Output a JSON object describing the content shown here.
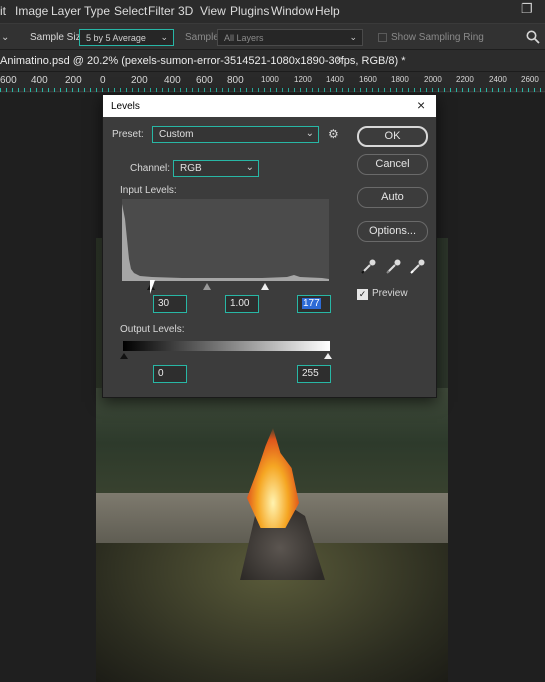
{
  "menubar": {
    "items": [
      "it",
      "Image",
      "Layer",
      "Type",
      "Select",
      "Filter",
      "3D",
      "View",
      "Plugins",
      "Window",
      "Help"
    ],
    "restore_glyph": "❐"
  },
  "options": {
    "sample_size_label": "Sample Size:",
    "sample_size_value": "5 by 5 Average",
    "sample_label": "Sample:",
    "sample_value": "All Layers",
    "show_ring_label": "Show Sampling Ring"
  },
  "document": {
    "tab_title": "Animatino.psd @ 20.2% (pexels-sumon-error-3514521-1080x1890-30fps, RGB/8) *",
    "close_glyph": "×"
  },
  "ruler": {
    "ticks": [
      "600",
      "400",
      "200",
      "0",
      "200",
      "400",
      "600",
      "800",
      "1000",
      "1200",
      "1400",
      "1600",
      "1800",
      "2000",
      "2200",
      "2400",
      "2600"
    ]
  },
  "levels": {
    "title": "Levels",
    "preset_label": "Preset:",
    "preset_value": "Custom",
    "channel_label": "Channel:",
    "channel_value": "RGB",
    "input_label": "Input Levels:",
    "input_black": "30",
    "input_gamma": "1.00",
    "input_white": "177",
    "output_label": "Output Levels:",
    "output_black": "0",
    "output_white": "255",
    "ok_label": "OK",
    "cancel_label": "Cancel",
    "auto_label": "Auto",
    "options_label": "Options...",
    "preview_label": "Preview",
    "preview_checked": true,
    "close_glyph": "×",
    "gear_glyph": "⚙"
  },
  "colors": {
    "accent": "#28b7a5",
    "selection": "#2d6bd6"
  }
}
